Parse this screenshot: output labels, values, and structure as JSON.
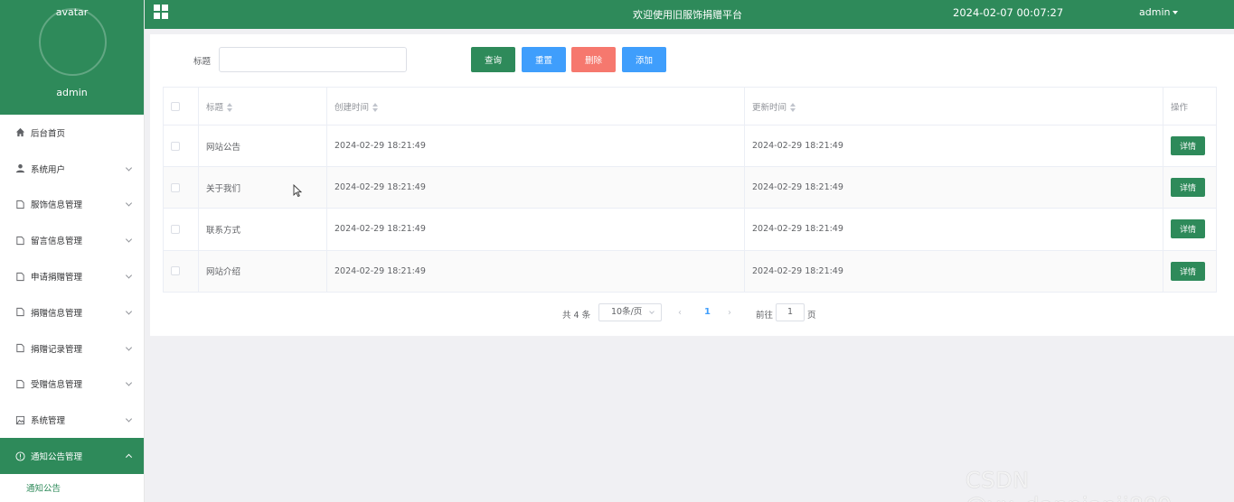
{
  "profile": {
    "avatar_text": "avatar",
    "name": "admin"
  },
  "sidebar": {
    "items": [
      {
        "label": "后台首页",
        "icon": "home-icon",
        "has_children": false
      },
      {
        "label": "系统用户",
        "icon": "user-icon",
        "has_children": true
      },
      {
        "label": "服饰信息管理",
        "icon": "doc-icon",
        "has_children": true
      },
      {
        "label": "留言信息管理",
        "icon": "doc-icon",
        "has_children": true
      },
      {
        "label": "申请捐赠管理",
        "icon": "doc-icon",
        "has_children": true
      },
      {
        "label": "捐赠信息管理",
        "icon": "doc-icon",
        "has_children": true
      },
      {
        "label": "捐赠记录管理",
        "icon": "doc-icon",
        "has_children": true
      },
      {
        "label": "受赠信息管理",
        "icon": "doc-icon",
        "has_children": true
      },
      {
        "label": "系统管理",
        "icon": "picture-icon",
        "has_children": true
      },
      {
        "label": "通知公告管理",
        "icon": "info-circle-icon",
        "has_children": true,
        "active": true
      }
    ],
    "submenu": {
      "label": "通知公告"
    }
  },
  "header": {
    "title": "欢迎使用旧服饰捐赠平台",
    "datetime": "2024-02-07 00:07:27",
    "user": "admin"
  },
  "search": {
    "label": "标题",
    "value": "",
    "placeholder": ""
  },
  "buttons": {
    "query": "查询",
    "reset": "重置",
    "delete": "删除",
    "add": "添加"
  },
  "table": {
    "columns": [
      "标题",
      "创建时间",
      "更新时间",
      "操作"
    ],
    "rows": [
      {
        "title": "网站公告",
        "created": "2024-02-29 18:21:49",
        "updated": "2024-02-29 18:21:49",
        "action": "详情"
      },
      {
        "title": "关于我们",
        "created": "2024-02-29 18:21:49",
        "updated": "2024-02-29 18:21:49",
        "action": "详情"
      },
      {
        "title": "联系方式",
        "created": "2024-02-29 18:21:49",
        "updated": "2024-02-29 18:21:49",
        "action": "详情"
      },
      {
        "title": "网站介绍",
        "created": "2024-02-29 18:21:49",
        "updated": "2024-02-29 18:21:49",
        "action": "详情"
      }
    ]
  },
  "pagination": {
    "total": "共 4 条",
    "page_size": "10条/页",
    "current_page": "1",
    "goto_label": "前往",
    "goto_value": "1",
    "goto_unit": "页",
    "prev_icon": "chevron-left-icon",
    "next_icon": "chevron-right-icon"
  },
  "watermark": "CSDN @vx_danpianji889",
  "colors": {
    "primary": "#2e8a5a",
    "blue": "#3f9efc",
    "danger": "#f6786e"
  }
}
